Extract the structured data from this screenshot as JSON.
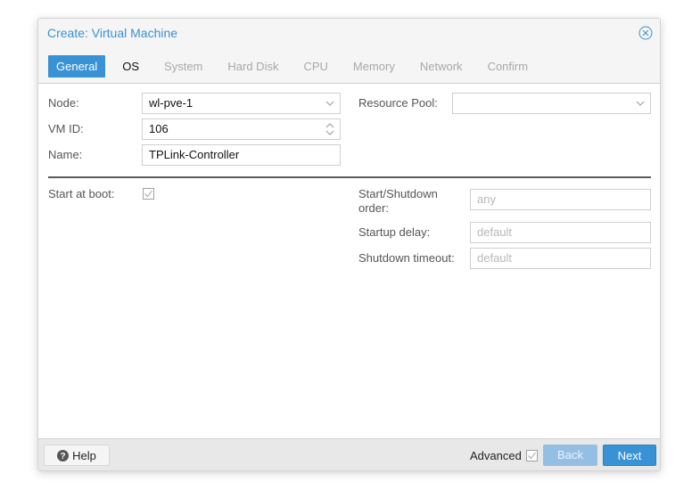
{
  "window": {
    "title": "Create: Virtual Machine",
    "close_icon": "close-circle-icon"
  },
  "tabs": [
    {
      "label": "General",
      "state": "active"
    },
    {
      "label": "OS",
      "state": "enabled"
    },
    {
      "label": "System",
      "state": "disabled"
    },
    {
      "label": "Hard Disk",
      "state": "disabled"
    },
    {
      "label": "CPU",
      "state": "disabled"
    },
    {
      "label": "Memory",
      "state": "disabled"
    },
    {
      "label": "Network",
      "state": "disabled"
    },
    {
      "label": "Confirm",
      "state": "disabled"
    }
  ],
  "form": {
    "node": {
      "label": "Node:",
      "value": "wl-pve-1"
    },
    "vmid": {
      "label": "VM ID:",
      "value": "106"
    },
    "name": {
      "label": "Name:",
      "value": "TPLink-Controller"
    },
    "resource_pool": {
      "label": "Resource Pool:",
      "value": ""
    },
    "start_at_boot": {
      "label": "Start at boot:",
      "checked": false
    },
    "startup_order": {
      "label": "Start/Shutdown order:",
      "placeholder": "any"
    },
    "startup_delay": {
      "label": "Startup delay:",
      "placeholder": "default"
    },
    "shutdown_timeout": {
      "label": "Shutdown timeout:",
      "placeholder": "default"
    }
  },
  "footer": {
    "help_label": "Help",
    "advanced_label": "Advanced",
    "advanced_checked": false,
    "back_label": "Back",
    "next_label": "Next"
  },
  "colors": {
    "accent": "#3892d4",
    "disabled_button": "#94bfe3",
    "tab_disabled_text": "#a8a8a8"
  }
}
